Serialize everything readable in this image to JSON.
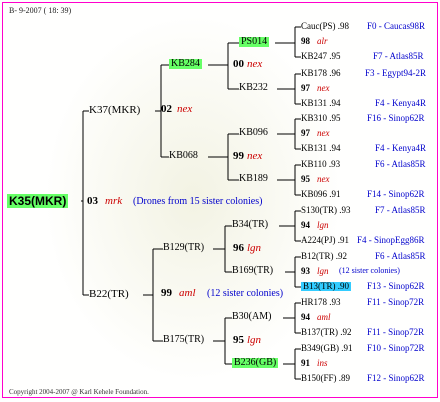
{
  "header": "B-  9-2007 ( 18: 39)",
  "footer": "Copyright 2004-2007 @ Karl Kehele Foundation.",
  "root": {
    "name": "K35(MKR)",
    "num": "03",
    "type": "mrk",
    "note": "(Drones from 15 sister colonies)"
  },
  "sire": {
    "name": "K37(MKR)",
    "num": "02",
    "type": "nex"
  },
  "dam": {
    "name": "B22(TR)",
    "num": "99",
    "type": "aml",
    "note": "(12 sister colonies)"
  },
  "kb284": {
    "name": "KB284",
    "num": "00",
    "type": "nex"
  },
  "kb068": {
    "name": "KB068",
    "num": "99",
    "type": "nex"
  },
  "b129": {
    "name": "B129(TR)",
    "num": "96",
    "type": "lgn"
  },
  "b175": {
    "name": "B175(TR)",
    "num": "95",
    "type": "lgn"
  },
  "ps014": {
    "name": "PS014"
  },
  "kb232": {
    "name": "KB232"
  },
  "kb096": {
    "name": "KB096"
  },
  "kb189": {
    "name": "KB189"
  },
  "b34": {
    "name": "B34(TR)"
  },
  "b169": {
    "name": "B169(TR)"
  },
  "b30": {
    "name": "B30(AM)"
  },
  "b236": {
    "name": "B236(GB)"
  },
  "right": [
    {
      "a": "Cauc(PS) .98",
      "b": "F0 - Caucas98R"
    },
    {
      "num": "98",
      "type": "alr"
    },
    {
      "a": "KB247 .95",
      "b": "F7 - Atlas85R"
    },
    {
      "a": "KB178 .96",
      "b": "F3 - Egypt94-2R"
    },
    {
      "num": "97",
      "type": "nex"
    },
    {
      "a": "KB131 .94",
      "b": "F4 - Kenya4R"
    },
    {
      "a": "KB310 .95",
      "b": "F16 - Sinop62R"
    },
    {
      "num": "97",
      "type": "nex"
    },
    {
      "a": "KB131 .94",
      "b": "F4 - Kenya4R"
    },
    {
      "a": "KB110 .93",
      "b": "F6 - Atlas85R"
    },
    {
      "num": "95",
      "type": "nex"
    },
    {
      "a": "KB096 .91",
      "b": "F14 - Sinop62R"
    },
    {
      "a": "S130(TR) .93",
      "b": "F7 - Atlas85R"
    },
    {
      "num": "94",
      "type": "lgn"
    },
    {
      "a": "A224(PJ) .91",
      "b": "F4 - SinopEgg86R"
    },
    {
      "a": "B12(TR) .92",
      "b": "F6 - Atlas85R"
    },
    {
      "num": "93",
      "type": "lgn",
      "note": "(12 sister colonies)"
    },
    {
      "a": "B13(TR) .90",
      "b": "F13 - Sinop62R"
    },
    {
      "a": "HR178 .93",
      "b": "F11 - Sinop72R"
    },
    {
      "num": "94",
      "type": "aml"
    },
    {
      "a": "B137(TR) .92",
      "b": "F11 - Sinop72R"
    },
    {
      "a": "B349(GB) .91",
      "b": "F10 - Sinop72R"
    },
    {
      "num": "91",
      "type": "ins"
    },
    {
      "a": "B150(FF) .89",
      "b": "F12 - Sinop62R"
    }
  ]
}
